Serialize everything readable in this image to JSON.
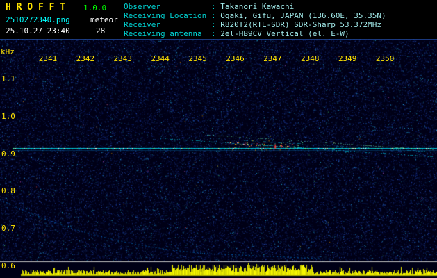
{
  "app": {
    "title": "H R O F F T",
    "version": "1.0.0",
    "filename": "2510272340.png",
    "mode": "meteor",
    "datetime": "25.10.27 23:40",
    "count": "28"
  },
  "info": {
    "rows": [
      {
        "label": "Observer",
        "value": "Takanori Kawachi"
      },
      {
        "label": "Receiving Location",
        "value": "Ogaki, Gifu, JAPAN (136.60E, 35.35N)"
      },
      {
        "label": "Receiver",
        "value": "R820T2(RTL-SDR) SDR-Sharp 53.372MHz"
      },
      {
        "label": "Receiving antenna",
        "value": "2el-HB9CV Vertical (el. E-W)"
      }
    ]
  },
  "spectrogram": {
    "unit_label": "kHz",
    "time_labels": [
      "2341",
      "2342",
      "2343",
      "2344",
      "2345",
      "2346",
      "2347",
      "2348",
      "2349",
      "2350"
    ],
    "freq_labels": [
      "1.1",
      "1.0",
      "0.9",
      "0.8",
      "0.7",
      "0.6"
    ]
  },
  "colors": {
    "background": "#000000",
    "title_yellow": "#ffe400",
    "version_green": "#00ff00",
    "filename_cyan": "#00ffff",
    "white_text": "#ffffff",
    "info_label": "#00d4d4",
    "info_value": "#a0e8e8",
    "axis_yellow": "#ffe400",
    "carrier_cyan": "#00d2e6",
    "bars_yellow": "#e8e800"
  }
}
